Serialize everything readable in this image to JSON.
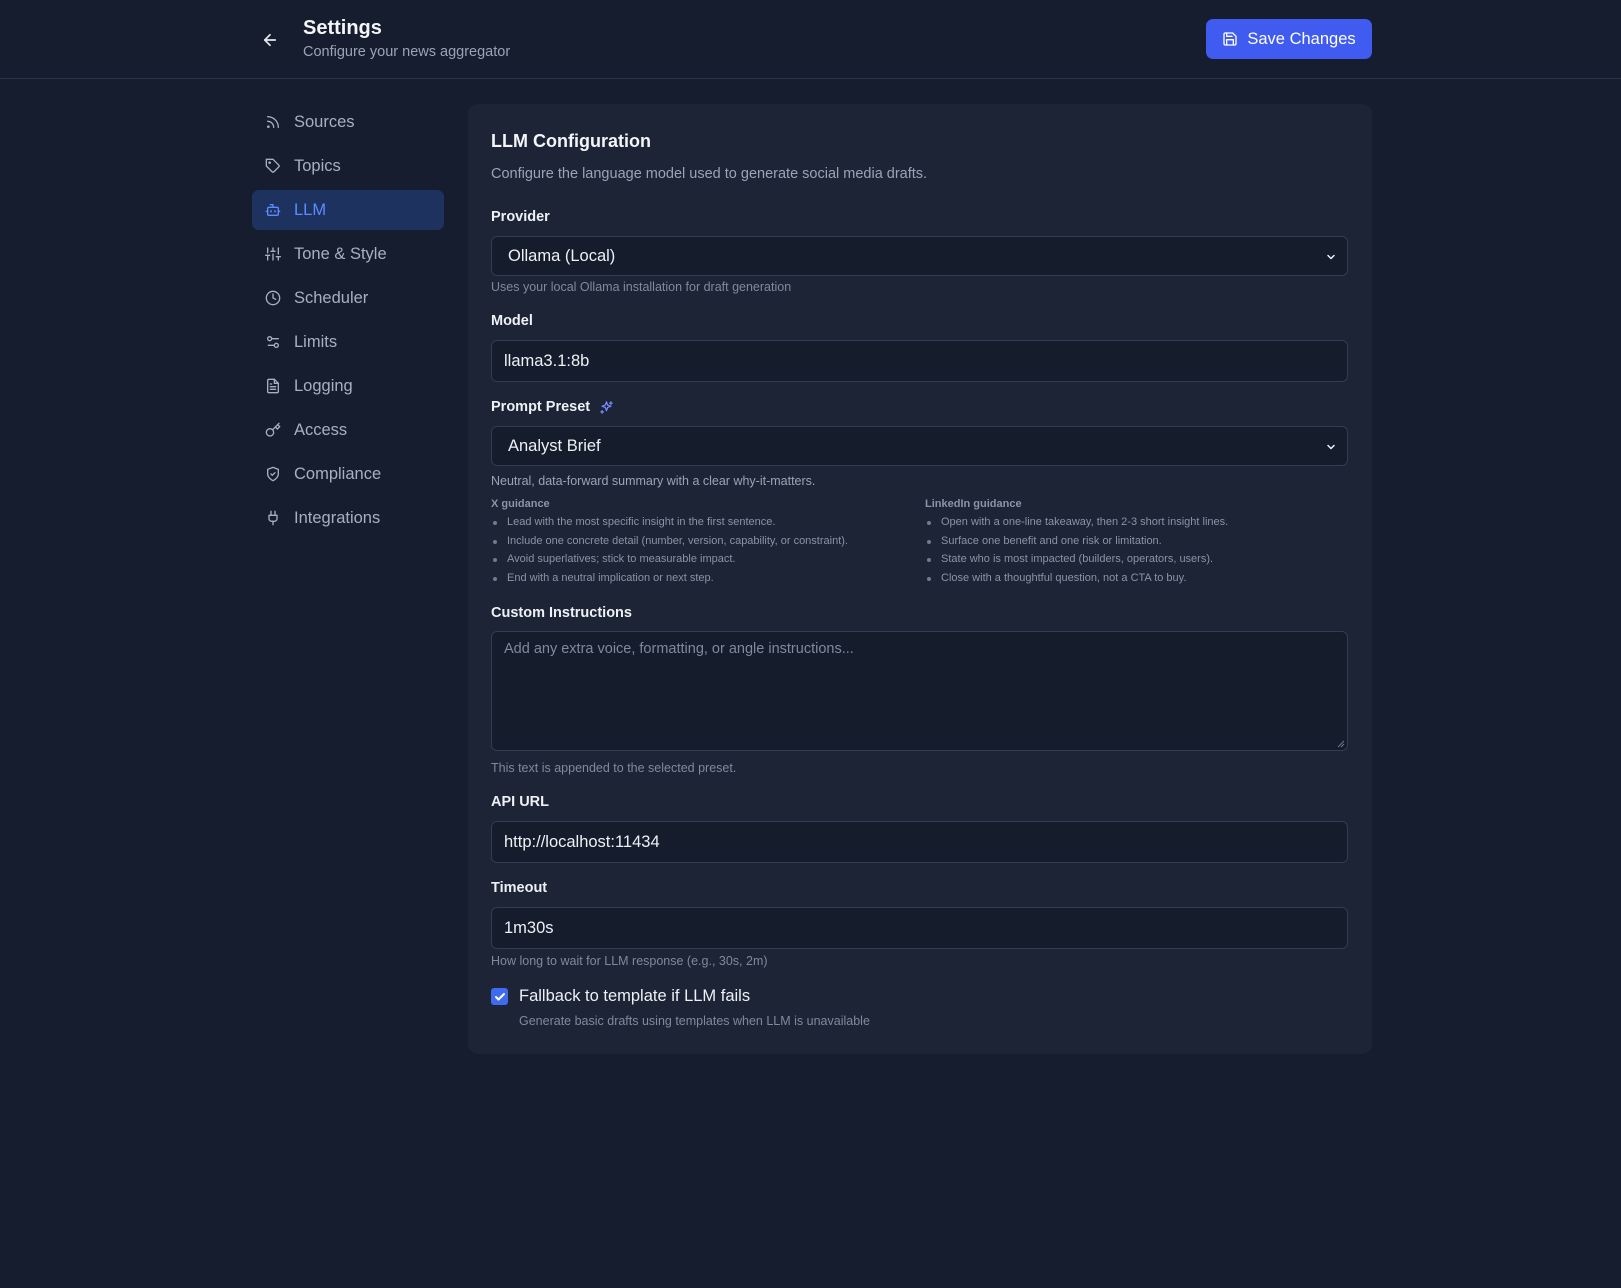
{
  "header": {
    "title": "Settings",
    "subtitle": "Configure your news aggregator",
    "save_label": "Save Changes"
  },
  "sidebar": {
    "items": [
      {
        "label": "Sources",
        "icon": "rss-icon"
      },
      {
        "label": "Topics",
        "icon": "tag-icon"
      },
      {
        "label": "LLM",
        "icon": "bot-icon",
        "active": true
      },
      {
        "label": "Tone & Style",
        "icon": "sliders-icon"
      },
      {
        "label": "Scheduler",
        "icon": "clock-icon"
      },
      {
        "label": "Limits",
        "icon": "settings-toggle-icon"
      },
      {
        "label": "Logging",
        "icon": "file-text-icon"
      },
      {
        "label": "Access",
        "icon": "key-icon"
      },
      {
        "label": "Compliance",
        "icon": "shield-check-icon"
      },
      {
        "label": "Integrations",
        "icon": "plug-icon"
      }
    ]
  },
  "panel": {
    "title": "LLM Configuration",
    "description": "Configure the language model used to generate social media drafts.",
    "provider": {
      "label": "Provider",
      "value": "Ollama (Local)",
      "hint": "Uses your local Ollama installation for draft generation"
    },
    "model": {
      "label": "Model",
      "value": "llama3.1:8b"
    },
    "preset": {
      "label": "Prompt Preset",
      "value": "Analyst Brief",
      "description": "Neutral, data-forward summary with a clear why-it-matters."
    },
    "x_guidance": {
      "title": "X guidance",
      "items": [
        "Lead with the most specific insight in the first sentence.",
        "Include one concrete detail (number, version, capability, or constraint).",
        "Avoid superlatives; stick to measurable impact.",
        "End with a neutral implication or next step."
      ]
    },
    "linkedin_guidance": {
      "title": "LinkedIn guidance",
      "items": [
        "Open with a one-line takeaway, then 2-3 short insight lines.",
        "Surface one benefit and one risk or limitation.",
        "State who is most impacted (builders, operators, users).",
        "Close with a thoughtful question, not a CTA to buy."
      ]
    },
    "custom": {
      "label": "Custom Instructions",
      "placeholder": "Add any extra voice, formatting, or angle instructions...",
      "hint": "This text is appended to the selected preset."
    },
    "api_url": {
      "label": "API URL",
      "value": "http://localhost:11434"
    },
    "timeout": {
      "label": "Timeout",
      "value": "1m30s",
      "hint": "How long to wait for LLM response (e.g., 30s, 2m)"
    },
    "fallback": {
      "label": "Fallback to template if LLM fails",
      "hint": "Generate basic drafts using templates when LLM is unavailable",
      "checked": true
    }
  },
  "colors": {
    "background": "#161d2f",
    "panel": "#1c2435",
    "accent": "#3f5bf0",
    "active_nav_bg": "#1e3260",
    "active_nav_text": "#5b8cff"
  }
}
